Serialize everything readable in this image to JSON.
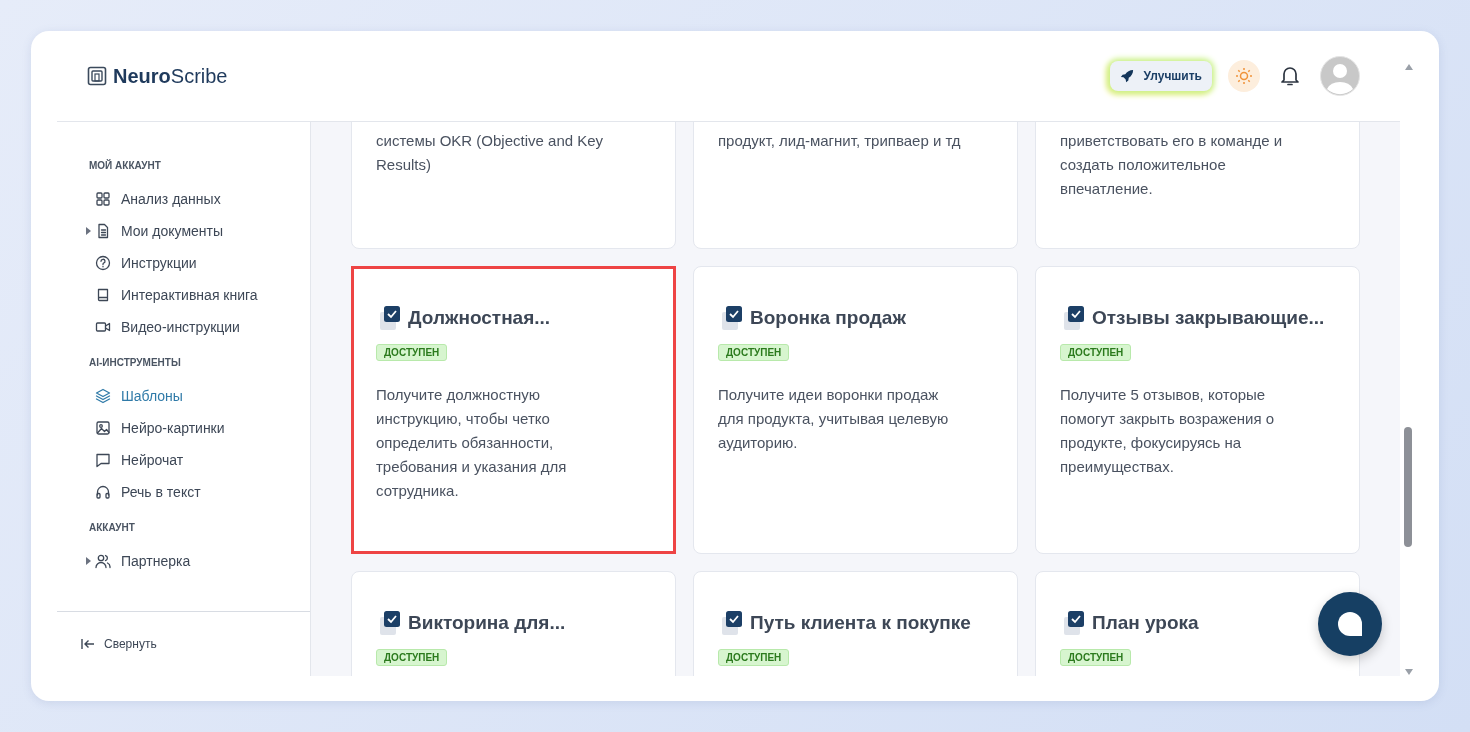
{
  "header": {
    "logo": {
      "bold": "Neuro",
      "light": "Scribe"
    },
    "upgrade_button": "Улучшить"
  },
  "sidebar": {
    "sections": [
      {
        "title": "МОЙ АККАУНТ",
        "items": [
          {
            "label": "Анализ данных",
            "kind": "grid",
            "selected": false
          },
          {
            "label": "Мои документы",
            "kind": "doc",
            "selected": false,
            "expanded": false
          },
          {
            "label": "Инструкции",
            "kind": "help",
            "selected": false
          },
          {
            "label": "Интерактивная книга",
            "kind": "book",
            "selected": false
          },
          {
            "label": "Видео-инструкции",
            "kind": "video",
            "selected": false
          }
        ]
      },
      {
        "title": "AI-ИНСТРУМЕНТЫ",
        "items": [
          {
            "label": "Шаблоны",
            "kind": "layers",
            "selected": true
          },
          {
            "label": "Нейро-картинки",
            "kind": "image",
            "selected": false
          },
          {
            "label": "Нейрочат",
            "kind": "chat",
            "selected": false
          },
          {
            "label": "Речь в текст",
            "kind": "headphones",
            "selected": false
          }
        ]
      },
      {
        "title": "АККАУНТ",
        "items": [
          {
            "label": "Партнерка",
            "kind": "users",
            "selected": false,
            "expanded": false
          }
        ]
      }
    ],
    "collapse": "Свернуть"
  },
  "cards": [
    {
      "description": "системы OKR (Objective and Key Results)",
      "selected": false
    },
    {
      "description": "продукт, лид-магнит, трипваер и тд",
      "selected": false
    },
    {
      "description": "приветствовать его в команде и создать положительное впечатление.",
      "selected": false
    },
    {
      "title": "Должностная...",
      "badge": "ДОСТУПЕН",
      "description": "Получите должностную инструкцию, чтобы четко определить обязанности, требования и указания для сотрудника.",
      "selected": true
    },
    {
      "title": "Воронка продаж",
      "badge": "ДОСТУПЕН",
      "description": "Получите идеи воронки продаж для продукта, учитывая целевую аудиторию.",
      "selected": false
    },
    {
      "title": "Отзывы закрывающие...",
      "badge": "ДОСТУПЕН",
      "description": "Получите 5 отзывов, которые помогут закрыть возражения о продукте, фокусируясь на преимуществах.",
      "selected": false
    },
    {
      "title": "Викторина для...",
      "badge": "ДОСТУПЕН",
      "selected": false
    },
    {
      "title": "Путь клиента к покупке",
      "badge": "ДОСТУПЕН",
      "selected": false
    },
    {
      "title": "План урока",
      "badge": "ДОСТУПЕН",
      "selected": false
    }
  ]
}
